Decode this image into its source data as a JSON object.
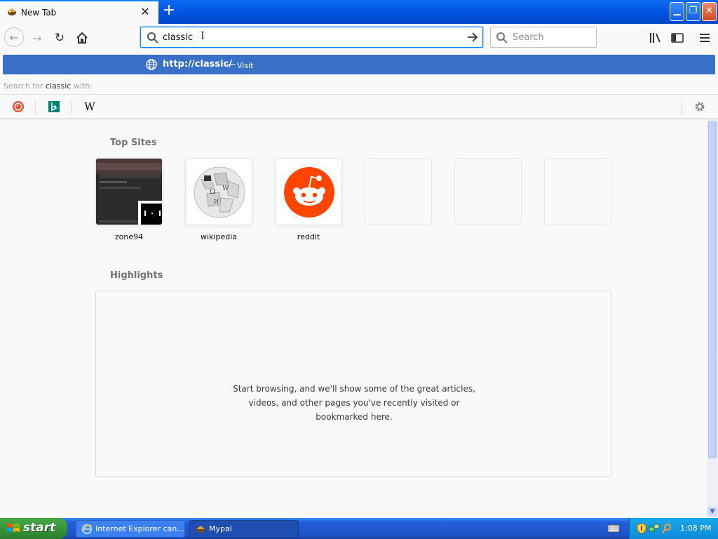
{
  "tab": {
    "title": "New Tab",
    "favicon": "mypal-icon"
  },
  "urlbar": {
    "value": "classic",
    "placeholder": ""
  },
  "searchbar": {
    "placeholder": "Search"
  },
  "dropdown": {
    "result_url": "http://classic/",
    "result_separator": "—",
    "result_action": "Visit",
    "search_for_prefix": "Search for",
    "search_for_term": "classic",
    "search_for_suffix": "with:",
    "engines": [
      "duckduckgo-icon",
      "bing-icon",
      "wikipedia-icon"
    ],
    "wiki_glyph": "W"
  },
  "content": {
    "top_sites_title": "Top Sites",
    "top_sites": [
      {
        "label": "zone94"
      },
      {
        "label": "wikipedia"
      },
      {
        "label": "reddit"
      }
    ],
    "highlights_title": "Highlights",
    "highlights_message": "Start browsing, and we'll show some of the great articles, videos, and other pages you've recently visited or bookmarked here."
  },
  "taskbar": {
    "start_label": "start",
    "tasks": [
      {
        "label": "Internet Explorer can..."
      },
      {
        "label": "Mypal"
      }
    ],
    "clock": "1:08 PM"
  },
  "colors": {
    "accent": "#0a84ff",
    "dropdown_highlight": "#3971c9",
    "reddit": "#ff4500",
    "xp_blue": "#245edb",
    "xp_start": "#379537"
  }
}
